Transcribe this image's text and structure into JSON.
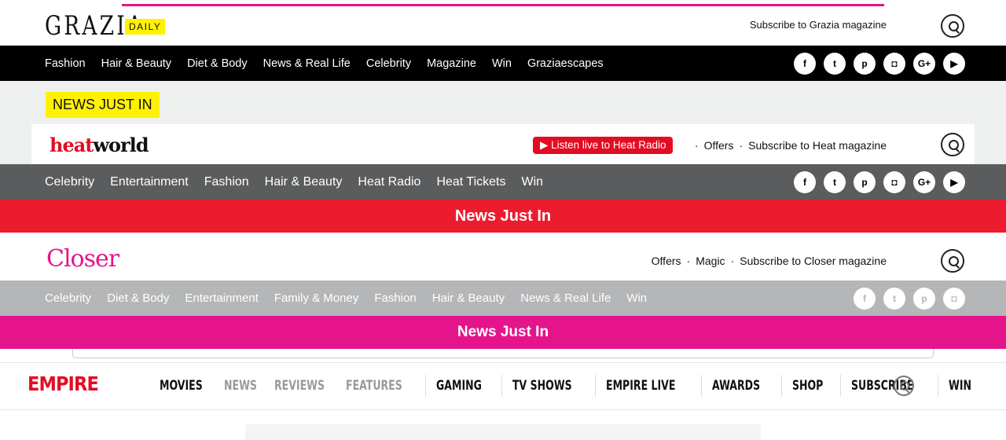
{
  "grazia": {
    "logo": "GRAZIA",
    "daily": "DAILY",
    "subscribe": "Subscribe to Grazia magazine",
    "nav": [
      "Fashion",
      "Hair & Beauty",
      "Diet & Body",
      "News & Real Life",
      "Celebrity",
      "Magazine",
      "Win",
      "Graziaescapes"
    ],
    "news_label": "NEWS JUST IN",
    "colors": {
      "accent": "#fff200",
      "nav_bg": "#000000",
      "line": "#e5148a"
    }
  },
  "heat": {
    "logo_heat": "heat",
    "logo_world": "world",
    "listen": "Listen live to Heat Radio",
    "links": [
      "Offers",
      "Subscribe to Heat magazine"
    ],
    "nav": [
      "Celebrity",
      "Entertainment",
      "Fashion",
      "Hair & Beauty",
      "Heat Radio",
      "Heat Tickets",
      "Win"
    ],
    "news_label": "News Just In",
    "colors": {
      "accent": "#ec1c2e",
      "nav_bg": "#5b5c5d"
    }
  },
  "closer": {
    "logo": "Closer",
    "links": [
      "Offers",
      "Magic",
      "Subscribe to Closer magazine"
    ],
    "nav": [
      "Celebrity",
      "Diet & Body",
      "Entertainment",
      "Family & Money",
      "Fashion",
      "Hair & Beauty",
      "News & Real Life",
      "Win"
    ],
    "news_label": "News Just In",
    "colors": {
      "accent": "#e5148a",
      "nav_bg": "#b5b6b8"
    }
  },
  "empire": {
    "logo": "EMPIRE",
    "nav_primary": [
      "MOVIES"
    ],
    "nav_grey": [
      "NEWS",
      "REVIEWS",
      "FEATURES"
    ],
    "nav_secondary": [
      "GAMING",
      "TV SHOWS",
      "EMPIRE LIVE",
      "AWARDS",
      "SHOP",
      "SUBSCRIBE",
      "WIN"
    ],
    "colors": {
      "accent": "#e30d23"
    }
  },
  "socials_icons": [
    "facebook-icon",
    "twitter-icon",
    "pinterest-icon",
    "instagram-icon",
    "google-plus-icon",
    "youtube-icon"
  ]
}
